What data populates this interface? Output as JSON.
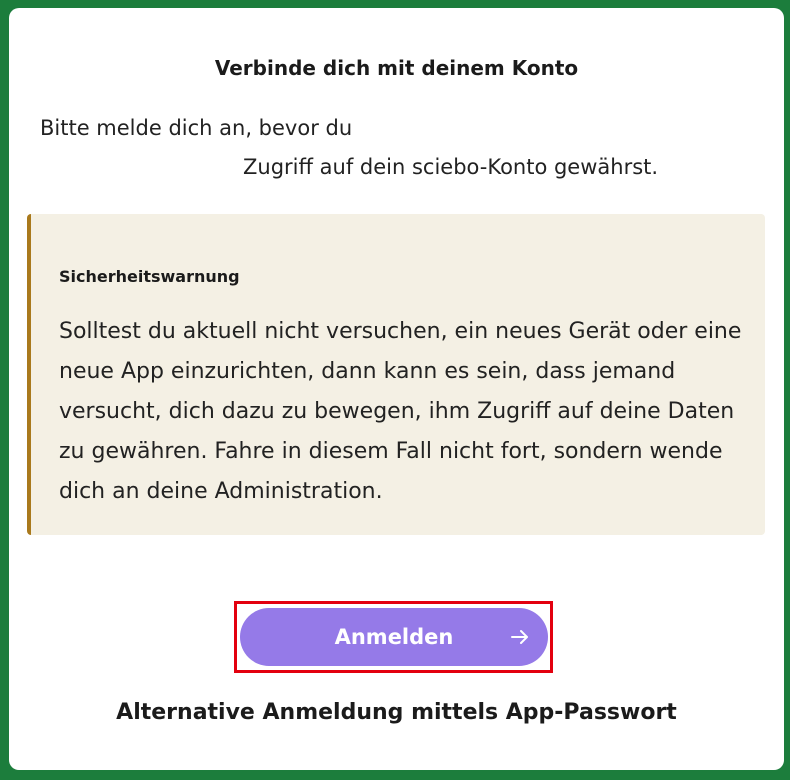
{
  "dialog": {
    "title": "Verbinde dich mit deinem Konto",
    "intro_line1": "Bitte melde dich an, bevor du",
    "intro_line2": "Zugriff auf dein sciebo-Konto gewährst."
  },
  "warning": {
    "title": "Sicherheitswarnung",
    "body": "Solltest du aktuell nicht versuchen, ein neues Gerät oder eine neue App einzurichten, dann kann es sein, dass jemand versucht, dich dazu zu bewegen, ihm Zugriff auf deine Daten zu gewähren. Fahre in diesem Fall nicht fort, sondern wende dich an deine Administration."
  },
  "actions": {
    "login_label": "Anmelden",
    "login_icon": "arrow-right-icon",
    "alt_login_label": "Alternative Anmeldung mittels App-Passwort"
  },
  "colors": {
    "background": "#1c7d3c",
    "button": "#957ae8",
    "warning_bg": "#f4f0e4",
    "warning_accent": "#a9791c",
    "highlight": "#e3000f"
  }
}
